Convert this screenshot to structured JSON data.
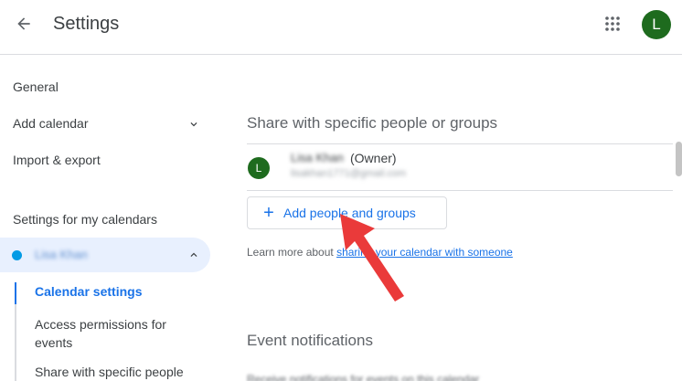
{
  "header": {
    "title": "Settings",
    "avatar_initial": "L"
  },
  "sidebar": {
    "items": [
      {
        "label": "General"
      },
      {
        "label": "Add calendar"
      },
      {
        "label": "Import & export"
      }
    ],
    "section_title": "Settings for my calendars",
    "calendar": {
      "name": "Lisa Khan",
      "color": "#039be5"
    },
    "sub_items": [
      {
        "label": "Calendar settings"
      },
      {
        "label": "Access permissions for events"
      },
      {
        "label": "Share with specific people"
      }
    ]
  },
  "main": {
    "share_title": "Share with specific people or groups",
    "owner": {
      "initial": "L",
      "name": "Lisa Khan",
      "role": "(Owner)",
      "email": "lisakhan1771@gmail.com"
    },
    "add_button_label": "Add people and groups",
    "learn_more_prefix": "Learn more about ",
    "learn_more_link": "sharing your calendar with someone",
    "event_title": "Event notifications",
    "event_subtitle": "Receive notifications for events on this calendar"
  },
  "colors": {
    "accent": "#1a73e8",
    "avatar": "#1e6b1e",
    "selected_bg": "#e8f0fe",
    "annotation_arrow": "#ea3a3a"
  }
}
